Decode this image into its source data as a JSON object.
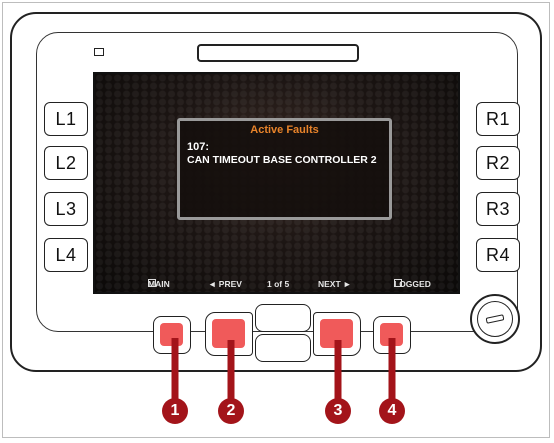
{
  "side_keys": {
    "left": [
      "L1",
      "L2",
      "L3",
      "L4"
    ],
    "right": [
      "R1",
      "R2",
      "R3",
      "R4"
    ]
  },
  "dialog": {
    "title": "Active Faults",
    "fault_code": "107:",
    "fault_text": "CAN TIMEOUT BASE CONTROLLER 2"
  },
  "softkeys": {
    "main": "MAIN",
    "prev": "◄ PREV",
    "page": "1 of 5",
    "next": "NEXT ►",
    "logged": "LOGGED"
  },
  "callouts": [
    "1",
    "2",
    "3",
    "4"
  ],
  "colors": {
    "highlight": "#f05a5a",
    "callout": "#a3141a",
    "dialog_title": "#e8832a"
  }
}
